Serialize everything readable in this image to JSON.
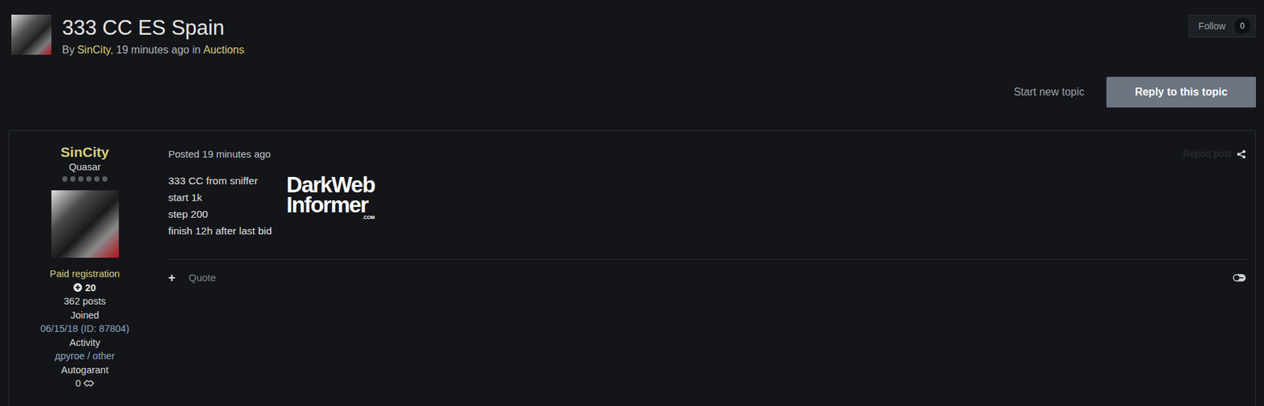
{
  "topic": {
    "title": "333 CC ES Spain",
    "by_label": "By",
    "author": "SinCity",
    "meta": ", 19 minutes ago in",
    "forum": "Auctions"
  },
  "follow": {
    "label": "Follow",
    "count": "0"
  },
  "actions": [
    {
      "label": "Start new topic",
      "kind": "link"
    },
    {
      "label": "Reply to this topic",
      "kind": "primary"
    }
  ],
  "post": {
    "author": {
      "name": "SinCity",
      "rank": "Quasar",
      "pips": [
        {
          "filled": false
        },
        {
          "filled": false
        },
        {
          "filled": false
        },
        {
          "filled": false
        },
        {
          "filled": false
        },
        {
          "filled": false
        }
      ],
      "group": "Paid registration",
      "reputation": "20",
      "posts": "362 posts",
      "fields": [
        {
          "label": "Joined",
          "value": "06/15/18 (ID: 87804)"
        },
        {
          "label": "Activity",
          "value": "другое / other"
        },
        {
          "label": "Autogarant",
          "value": "0"
        }
      ]
    },
    "posted": "Posted 19 minutes ago",
    "report": "Report post",
    "lines": [
      "333 CC from sniffer",
      "start 1k",
      "step 200",
      "finish 12h after last bid"
    ],
    "watermark": {
      "line1": "DarkWeb",
      "line2": "Informer",
      "suffix": ".COM"
    },
    "footer": {
      "plus": "+",
      "quote": "Quote"
    }
  }
}
